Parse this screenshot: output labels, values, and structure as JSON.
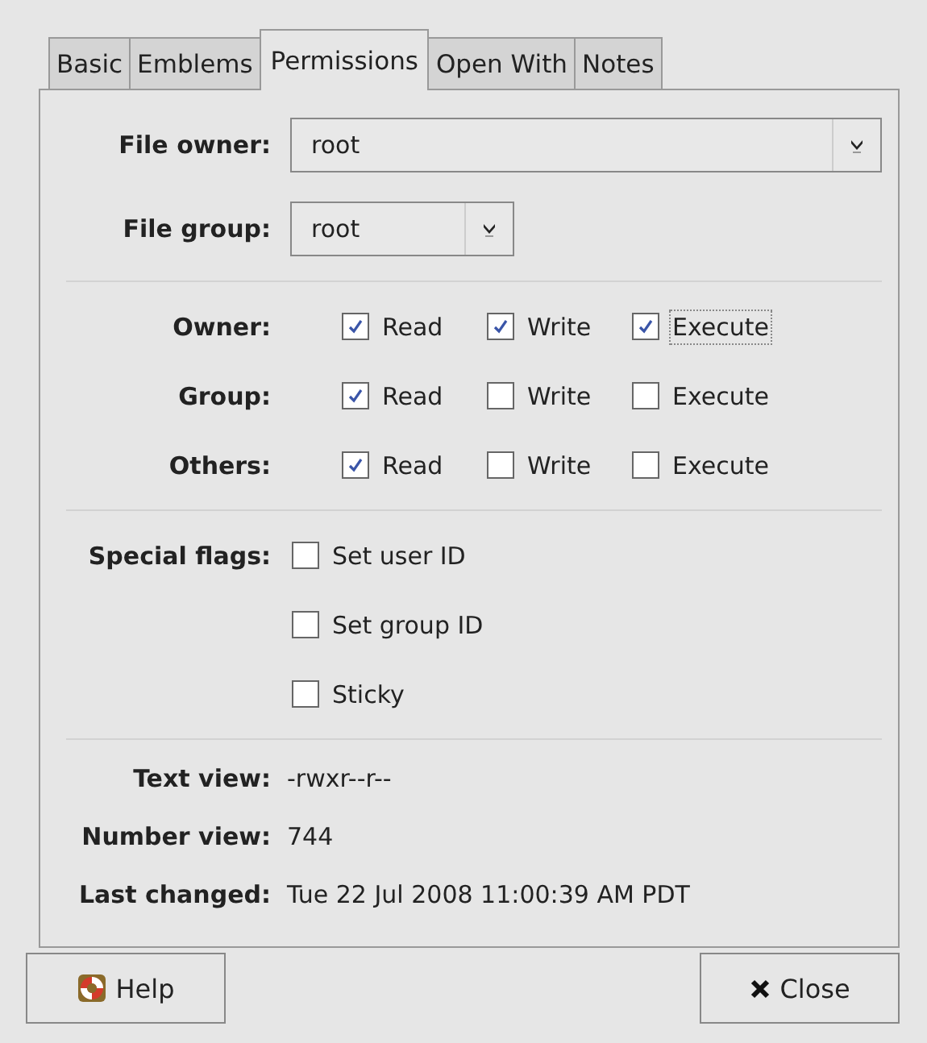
{
  "tabs": [
    {
      "label": "Basic",
      "selected": false
    },
    {
      "label": "Emblems",
      "selected": false
    },
    {
      "label": "Permissions",
      "selected": true
    },
    {
      "label": "Open With",
      "selected": false
    },
    {
      "label": "Notes",
      "selected": false
    }
  ],
  "ownership": [
    {
      "label": "File owner:",
      "value": "root",
      "kind": "wide"
    },
    {
      "label": "File group:",
      "value": "root",
      "kind": "narrow"
    }
  ],
  "permissions": [
    {
      "label": "Owner:",
      "options": [
        {
          "label": "Read",
          "checked": true,
          "focused": false
        },
        {
          "label": "Write",
          "checked": true,
          "focused": false
        },
        {
          "label": "Execute",
          "checked": true,
          "focused": true
        }
      ]
    },
    {
      "label": "Group:",
      "options": [
        {
          "label": "Read",
          "checked": true,
          "focused": false
        },
        {
          "label": "Write",
          "checked": false,
          "focused": false
        },
        {
          "label": "Execute",
          "checked": false,
          "focused": false
        }
      ]
    },
    {
      "label": "Others:",
      "options": [
        {
          "label": "Read",
          "checked": true,
          "focused": false
        },
        {
          "label": "Write",
          "checked": false,
          "focused": false
        },
        {
          "label": "Execute",
          "checked": false,
          "focused": false
        }
      ]
    }
  ],
  "special_flags": {
    "label": "Special flags:",
    "options": [
      {
        "label": "Set user ID",
        "checked": false
      },
      {
        "label": "Set group ID",
        "checked": false
      },
      {
        "label": "Sticky",
        "checked": false
      }
    ]
  },
  "info": [
    {
      "label": "Text view:",
      "value": "-rwxr--r--"
    },
    {
      "label": "Number view:",
      "value": "744"
    },
    {
      "label": "Last changed:",
      "value": "Tue 22 Jul 2008 11:00:39 AM PDT"
    }
  ],
  "buttons": [
    {
      "label": "Help",
      "kind": "help"
    },
    {
      "label": "Close",
      "kind": "close"
    }
  ]
}
